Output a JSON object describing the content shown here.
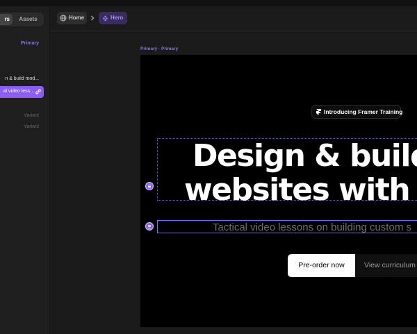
{
  "left_panel": {
    "tabs": [
      {
        "label": "rs"
      },
      {
        "label": "Assets"
      }
    ],
    "primary_tag": "Primary",
    "layers": [
      {
        "label": "n & build mod..."
      },
      {
        "label": "al video less..."
      }
    ],
    "variants": [
      "Variant",
      "Variant"
    ]
  },
  "breadcrumb": {
    "home": "Home",
    "current": "Hero"
  },
  "canvas": {
    "frame_label": "Primary · Primary",
    "badge": "Introducing Framer Training",
    "heading_line1": "Design & build m",
    "heading_line2": "websites with ze",
    "subheading": "Tactical video lessons on building custom s",
    "primary_button": "Pre-order now",
    "secondary_button": "View curriculum"
  },
  "colors": {
    "accent": "#8b5cf6",
    "background": "#1b1b1b",
    "frame": "#000000"
  }
}
